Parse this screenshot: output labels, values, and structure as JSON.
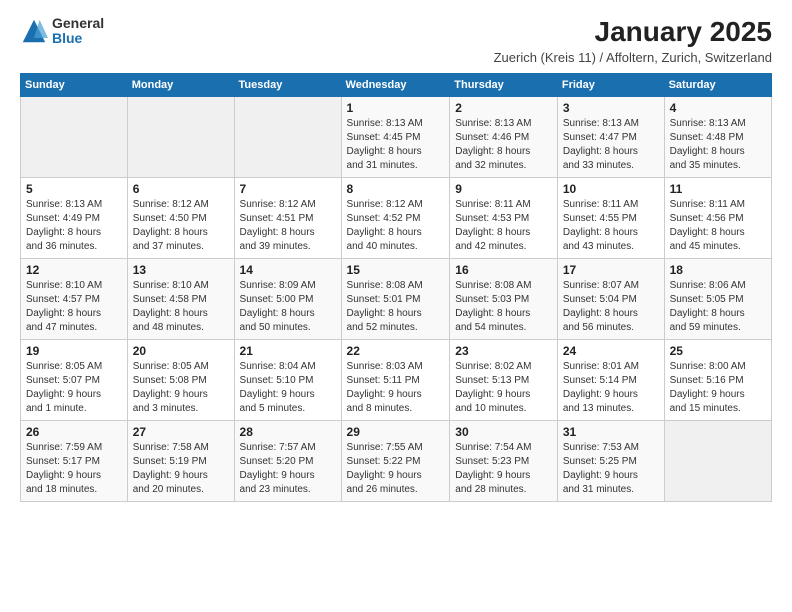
{
  "header": {
    "logo_general": "General",
    "logo_blue": "Blue",
    "title": "January 2025",
    "subtitle": "Zuerich (Kreis 11) / Affoltern, Zurich, Switzerland"
  },
  "days_of_week": [
    "Sunday",
    "Monday",
    "Tuesday",
    "Wednesday",
    "Thursday",
    "Friday",
    "Saturday"
  ],
  "weeks": [
    [
      {
        "day": "",
        "info": ""
      },
      {
        "day": "",
        "info": ""
      },
      {
        "day": "",
        "info": ""
      },
      {
        "day": "1",
        "info": "Sunrise: 8:13 AM\nSunset: 4:45 PM\nDaylight: 8 hours\nand 31 minutes."
      },
      {
        "day": "2",
        "info": "Sunrise: 8:13 AM\nSunset: 4:46 PM\nDaylight: 8 hours\nand 32 minutes."
      },
      {
        "day": "3",
        "info": "Sunrise: 8:13 AM\nSunset: 4:47 PM\nDaylight: 8 hours\nand 33 minutes."
      },
      {
        "day": "4",
        "info": "Sunrise: 8:13 AM\nSunset: 4:48 PM\nDaylight: 8 hours\nand 35 minutes."
      }
    ],
    [
      {
        "day": "5",
        "info": "Sunrise: 8:13 AM\nSunset: 4:49 PM\nDaylight: 8 hours\nand 36 minutes."
      },
      {
        "day": "6",
        "info": "Sunrise: 8:12 AM\nSunset: 4:50 PM\nDaylight: 8 hours\nand 37 minutes."
      },
      {
        "day": "7",
        "info": "Sunrise: 8:12 AM\nSunset: 4:51 PM\nDaylight: 8 hours\nand 39 minutes."
      },
      {
        "day": "8",
        "info": "Sunrise: 8:12 AM\nSunset: 4:52 PM\nDaylight: 8 hours\nand 40 minutes."
      },
      {
        "day": "9",
        "info": "Sunrise: 8:11 AM\nSunset: 4:53 PM\nDaylight: 8 hours\nand 42 minutes."
      },
      {
        "day": "10",
        "info": "Sunrise: 8:11 AM\nSunset: 4:55 PM\nDaylight: 8 hours\nand 43 minutes."
      },
      {
        "day": "11",
        "info": "Sunrise: 8:11 AM\nSunset: 4:56 PM\nDaylight: 8 hours\nand 45 minutes."
      }
    ],
    [
      {
        "day": "12",
        "info": "Sunrise: 8:10 AM\nSunset: 4:57 PM\nDaylight: 8 hours\nand 47 minutes."
      },
      {
        "day": "13",
        "info": "Sunrise: 8:10 AM\nSunset: 4:58 PM\nDaylight: 8 hours\nand 48 minutes."
      },
      {
        "day": "14",
        "info": "Sunrise: 8:09 AM\nSunset: 5:00 PM\nDaylight: 8 hours\nand 50 minutes."
      },
      {
        "day": "15",
        "info": "Sunrise: 8:08 AM\nSunset: 5:01 PM\nDaylight: 8 hours\nand 52 minutes."
      },
      {
        "day": "16",
        "info": "Sunrise: 8:08 AM\nSunset: 5:03 PM\nDaylight: 8 hours\nand 54 minutes."
      },
      {
        "day": "17",
        "info": "Sunrise: 8:07 AM\nSunset: 5:04 PM\nDaylight: 8 hours\nand 56 minutes."
      },
      {
        "day": "18",
        "info": "Sunrise: 8:06 AM\nSunset: 5:05 PM\nDaylight: 8 hours\nand 59 minutes."
      }
    ],
    [
      {
        "day": "19",
        "info": "Sunrise: 8:05 AM\nSunset: 5:07 PM\nDaylight: 9 hours\nand 1 minute."
      },
      {
        "day": "20",
        "info": "Sunrise: 8:05 AM\nSunset: 5:08 PM\nDaylight: 9 hours\nand 3 minutes."
      },
      {
        "day": "21",
        "info": "Sunrise: 8:04 AM\nSunset: 5:10 PM\nDaylight: 9 hours\nand 5 minutes."
      },
      {
        "day": "22",
        "info": "Sunrise: 8:03 AM\nSunset: 5:11 PM\nDaylight: 9 hours\nand 8 minutes."
      },
      {
        "day": "23",
        "info": "Sunrise: 8:02 AM\nSunset: 5:13 PM\nDaylight: 9 hours\nand 10 minutes."
      },
      {
        "day": "24",
        "info": "Sunrise: 8:01 AM\nSunset: 5:14 PM\nDaylight: 9 hours\nand 13 minutes."
      },
      {
        "day": "25",
        "info": "Sunrise: 8:00 AM\nSunset: 5:16 PM\nDaylight: 9 hours\nand 15 minutes."
      }
    ],
    [
      {
        "day": "26",
        "info": "Sunrise: 7:59 AM\nSunset: 5:17 PM\nDaylight: 9 hours\nand 18 minutes."
      },
      {
        "day": "27",
        "info": "Sunrise: 7:58 AM\nSunset: 5:19 PM\nDaylight: 9 hours\nand 20 minutes."
      },
      {
        "day": "28",
        "info": "Sunrise: 7:57 AM\nSunset: 5:20 PM\nDaylight: 9 hours\nand 23 minutes."
      },
      {
        "day": "29",
        "info": "Sunrise: 7:55 AM\nSunset: 5:22 PM\nDaylight: 9 hours\nand 26 minutes."
      },
      {
        "day": "30",
        "info": "Sunrise: 7:54 AM\nSunset: 5:23 PM\nDaylight: 9 hours\nand 28 minutes."
      },
      {
        "day": "31",
        "info": "Sunrise: 7:53 AM\nSunset: 5:25 PM\nDaylight: 9 hours\nand 31 minutes."
      },
      {
        "day": "",
        "info": ""
      }
    ]
  ]
}
